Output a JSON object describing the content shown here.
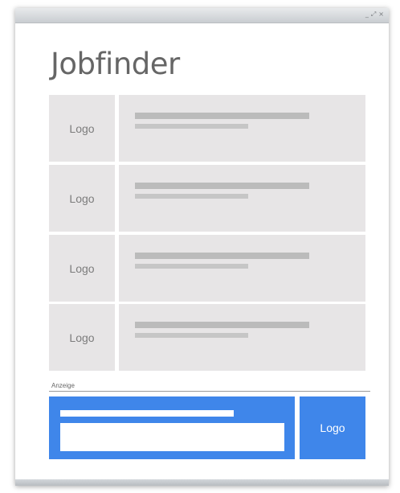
{
  "window": {
    "controls": {
      "minimize": "_",
      "restore": "⤢",
      "close": "×"
    }
  },
  "page": {
    "title": "Jobfinder"
  },
  "jobs": [
    {
      "logo": "Logo"
    },
    {
      "logo": "Logo"
    },
    {
      "logo": "Logo"
    },
    {
      "logo": "Logo"
    }
  ],
  "ad": {
    "label": "Anzeige",
    "logo": "Logo",
    "color": "#3f86ea"
  },
  "colors": {
    "placeholder_bg": "#e7e5e6",
    "placeholder_line": "#bbbbbb",
    "title_text": "#666666"
  }
}
